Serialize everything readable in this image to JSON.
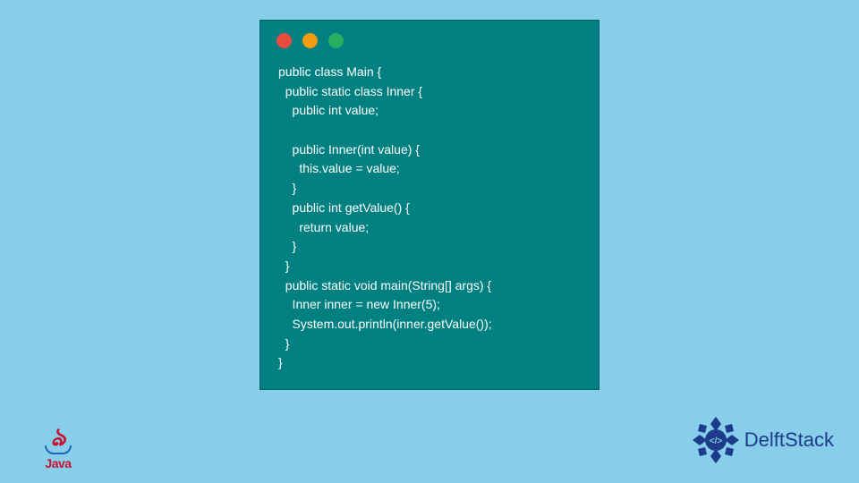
{
  "code": {
    "lines": [
      "public class Main {",
      "  public static class Inner {",
      "    public int value;",
      "",
      "    public Inner(int value) {",
      "      this.value = value;",
      "    }",
      "    public int getValue() {",
      "      return value;",
      "    }",
      "  }",
      "  public static void main(String[] args) {",
      "    Inner inner = new Inner(5);",
      "    System.out.println(inner.getValue());",
      "  }",
      "}"
    ]
  },
  "logos": {
    "java": "Java",
    "delftstack": "DelftStack"
  },
  "window": {
    "dots": [
      "red",
      "yellow",
      "green"
    ]
  }
}
